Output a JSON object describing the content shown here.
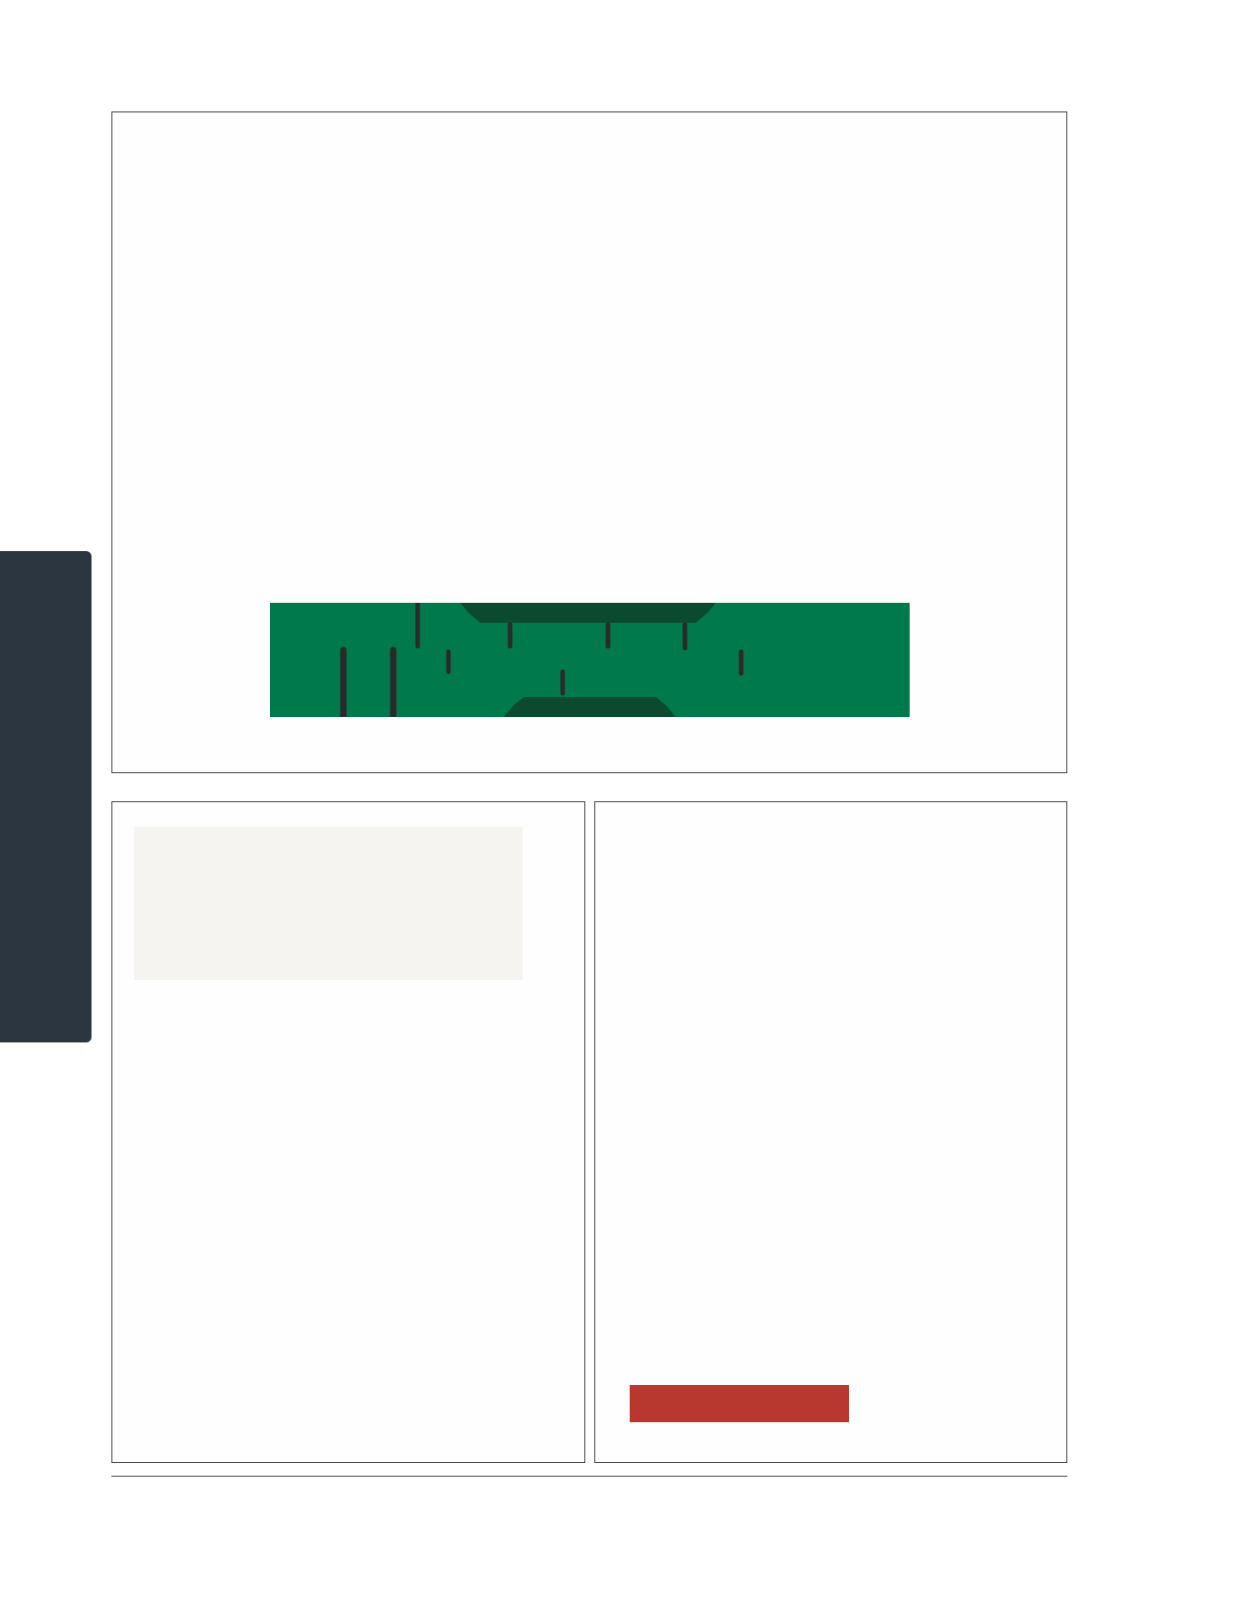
{
  "colors": {
    "side_tab": "#2b3640",
    "banner_green": "#007a4d",
    "banner_dark": "#0b4a2f",
    "banner_ink": "#2a2a2a",
    "grey_panel": "#f6f4f0",
    "red_bar": "#b8372e",
    "rule": "#3a3a3a"
  },
  "icons": {
    "banner_graphic": "green-banner-graphic",
    "side_tab": "side-tab-marker"
  }
}
